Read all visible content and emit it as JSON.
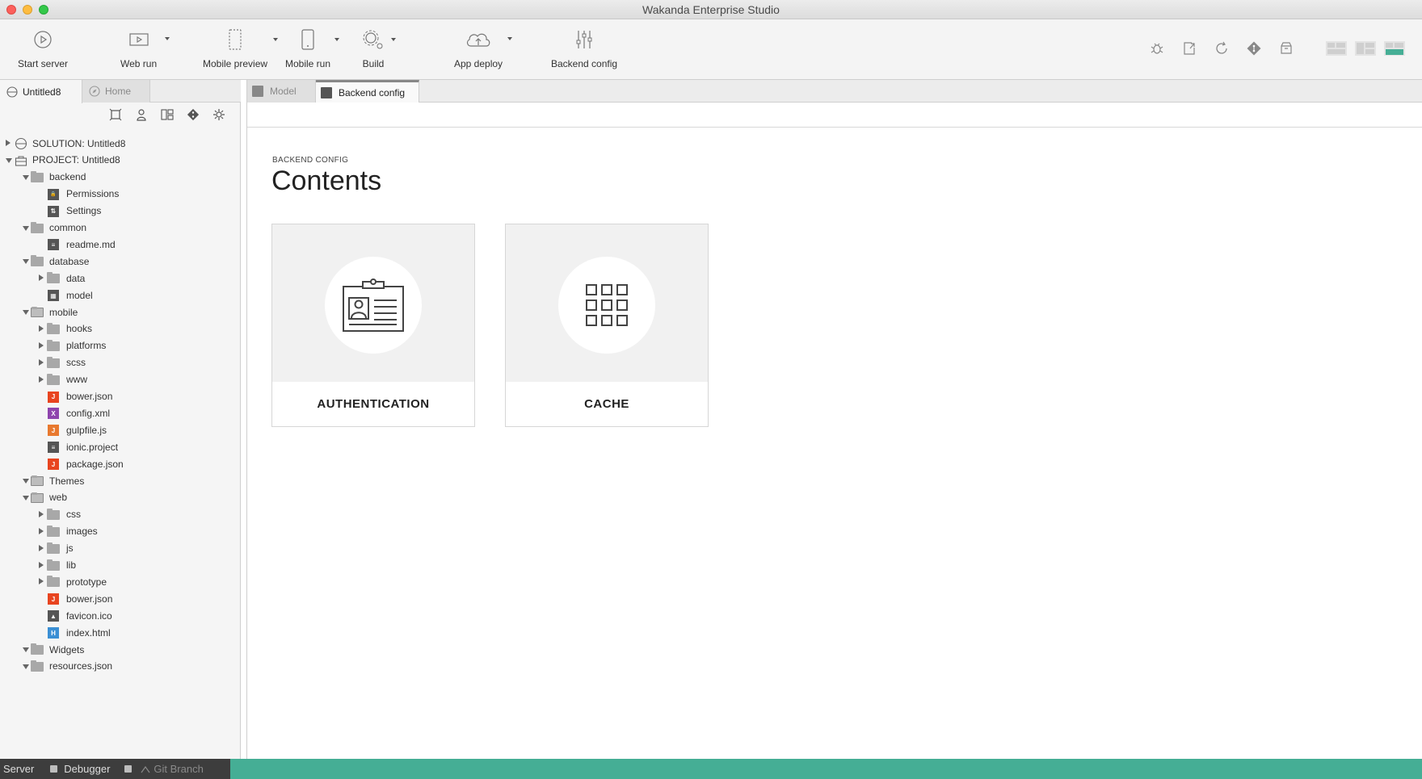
{
  "window": {
    "title": "Wakanda Enterprise Studio"
  },
  "toolbar": {
    "start_server": "Start server",
    "web_run": "Web run",
    "mobile_preview": "Mobile preview",
    "mobile_run": "Mobile run",
    "build": "Build",
    "app_deploy": "App deploy",
    "backend_config": "Backend config"
  },
  "left_panel": {
    "tabs": [
      {
        "label": "Untitled8",
        "active": true
      },
      {
        "label": "Home",
        "active": false
      }
    ],
    "tree": [
      {
        "label": "SOLUTION: Untitled8",
        "level": 0,
        "expanded": false,
        "icon": "solution-icon"
      },
      {
        "label": "PROJECT: Untitled8",
        "level": 0,
        "expanded": true,
        "icon": "project-icon"
      },
      {
        "label": "backend",
        "level": 1,
        "expanded": true,
        "icon": "folder-icon"
      },
      {
        "label": "Permissions",
        "level": 2,
        "icon": "lock-icon"
      },
      {
        "label": "Settings",
        "level": 2,
        "icon": "settings-sliders-icon"
      },
      {
        "label": "common",
        "level": 1,
        "expanded": true,
        "icon": "folder-icon"
      },
      {
        "label": "readme.md",
        "level": 2,
        "icon": "text-file-icon"
      },
      {
        "label": "database",
        "level": 1,
        "expanded": true,
        "icon": "folder-icon"
      },
      {
        "label": "data",
        "level": 2,
        "expanded": false,
        "icon": "folder-icon"
      },
      {
        "label": "model",
        "level": 2,
        "icon": "model-icon"
      },
      {
        "label": "mobile",
        "level": 1,
        "expanded": true,
        "icon": "mobile-folder-icon"
      },
      {
        "label": "hooks",
        "level": 2,
        "expanded": false,
        "icon": "folder-icon"
      },
      {
        "label": "platforms",
        "level": 2,
        "expanded": false,
        "icon": "folder-icon"
      },
      {
        "label": "scss",
        "level": 2,
        "expanded": false,
        "icon": "folder-icon"
      },
      {
        "label": "www",
        "level": 2,
        "expanded": false,
        "icon": "folder-icon"
      },
      {
        "label": "bower.json",
        "level": 2,
        "icon": "json-file-icon"
      },
      {
        "label": "config.xml",
        "level": 2,
        "icon": "xml-file-icon"
      },
      {
        "label": "gulpfile.js",
        "level": 2,
        "icon": "js-file-icon"
      },
      {
        "label": "ionic.project",
        "level": 2,
        "icon": "text-file-icon"
      },
      {
        "label": "package.json",
        "level": 2,
        "icon": "json-file-icon"
      },
      {
        "label": "Themes",
        "level": 1,
        "expanded": true,
        "icon": "themes-folder-icon"
      },
      {
        "label": "web",
        "level": 1,
        "expanded": true,
        "icon": "web-folder-icon"
      },
      {
        "label": "css",
        "level": 2,
        "expanded": false,
        "icon": "folder-icon"
      },
      {
        "label": "images",
        "level": 2,
        "expanded": false,
        "icon": "folder-icon"
      },
      {
        "label": "js",
        "level": 2,
        "expanded": false,
        "icon": "folder-icon"
      },
      {
        "label": "lib",
        "level": 2,
        "expanded": false,
        "icon": "folder-icon"
      },
      {
        "label": "prototype",
        "level": 2,
        "expanded": false,
        "icon": "folder-icon"
      },
      {
        "label": "bower.json",
        "level": 2,
        "icon": "json-file-icon"
      },
      {
        "label": "favicon.ico",
        "level": 2,
        "icon": "image-file-icon"
      },
      {
        "label": "index.html",
        "level": 2,
        "icon": "html-file-icon"
      },
      {
        "label": "Widgets",
        "level": 1,
        "expanded": true,
        "icon": "folder-icon"
      },
      {
        "label": "resources.json",
        "level": 1,
        "expanded": true,
        "icon": "folder-icon"
      }
    ]
  },
  "main": {
    "tabs": [
      {
        "label": "Model",
        "active": false
      },
      {
        "label": "Backend config",
        "active": true
      }
    ],
    "breadcrumb": "BACKEND CONFIG",
    "title": "Contents",
    "cards": [
      {
        "label": "AUTHENTICATION",
        "icon": "id-badge-icon"
      },
      {
        "label": "CACHE",
        "icon": "grid-icon"
      }
    ]
  },
  "statusbar": {
    "server": "Server",
    "debugger": "Debugger",
    "git_branch": "Git Branch"
  },
  "colors": {
    "accent": "#45ae95",
    "status_dark": "#3d3d3d",
    "json_icon": "#e8441f",
    "js_icon": "#e8792f",
    "xml_icon": "#8e44ad",
    "html_icon": "#3a8fd4"
  }
}
